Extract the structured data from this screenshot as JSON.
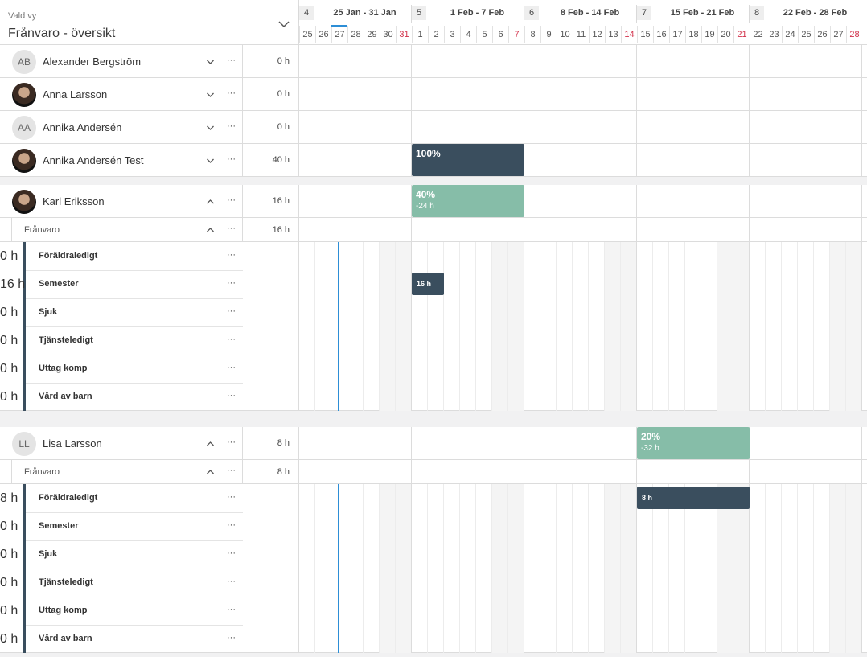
{
  "header": {
    "label": "Vald vy",
    "title": "Frånvaro - översikt",
    "weeks": [
      {
        "num": "4",
        "label": "25 Jan - 31 Jan"
      },
      {
        "num": "5",
        "label": "1 Feb - 7 Feb"
      },
      {
        "num": "6",
        "label": "8 Feb - 14 Feb"
      },
      {
        "num": "7",
        "label": "15 Feb - 21 Feb"
      },
      {
        "num": "8",
        "label": "22 Feb - 28 Feb"
      }
    ],
    "days": [
      "25",
      "26",
      "27",
      "28",
      "29",
      "30",
      "31",
      "1",
      "2",
      "3",
      "4",
      "5",
      "6",
      "7",
      "8",
      "9",
      "10",
      "11",
      "12",
      "13",
      "14",
      "15",
      "16",
      "17",
      "18",
      "19",
      "20",
      "21",
      "22",
      "23",
      "24",
      "25",
      "26",
      "27",
      "28"
    ]
  },
  "people": [
    {
      "initials": "AB",
      "name": "Alexander Bergström",
      "hours": "0 h"
    },
    {
      "initials": "",
      "name": "Anna Larsson",
      "hours": "0 h"
    },
    {
      "initials": "AA",
      "name": "Annika Andersén",
      "hours": "0 h"
    },
    {
      "initials": "",
      "name": "Annika Andersén Test",
      "hours": "40 h",
      "bar": {
        "pct": "100%"
      }
    }
  ],
  "karl": {
    "name": "Karl Eriksson",
    "hours": "16 h",
    "bar": {
      "pct": "40%",
      "sub": "-24 h"
    },
    "group": {
      "label": "Frånvaro",
      "hours": "16 h"
    },
    "items": [
      {
        "name": "Föräldraledigt",
        "hours": "0 h"
      },
      {
        "name": "Semester",
        "hours": "16 h",
        "bar": "16 h"
      },
      {
        "name": "Sjuk",
        "hours": "0 h"
      },
      {
        "name": "Tjänsteledigt",
        "hours": "0 h"
      },
      {
        "name": "Uttag komp",
        "hours": "0 h"
      },
      {
        "name": "Vård av barn",
        "hours": "0 h"
      }
    ]
  },
  "lisa": {
    "initials": "LL",
    "name": "Lisa Larsson",
    "hours": "8 h",
    "bar": {
      "pct": "20%",
      "sub": "-32 h"
    },
    "group": {
      "label": "Frånvaro",
      "hours": "8 h"
    },
    "items": [
      {
        "name": "Föräldraledigt",
        "hours": "8 h",
        "bar": "8 h"
      },
      {
        "name": "Semester",
        "hours": "0 h"
      },
      {
        "name": "Sjuk",
        "hours": "0 h"
      },
      {
        "name": "Tjänsteledigt",
        "hours": "0 h"
      },
      {
        "name": "Uttag komp",
        "hours": "0 h"
      },
      {
        "name": "Vård av barn",
        "hours": "0 h"
      }
    ]
  },
  "more_label": "···",
  "colors": {
    "accent": "#3a4e5e",
    "green": "#86bda8",
    "today": "#2d8ed6",
    "sunday": "#d2304a"
  }
}
